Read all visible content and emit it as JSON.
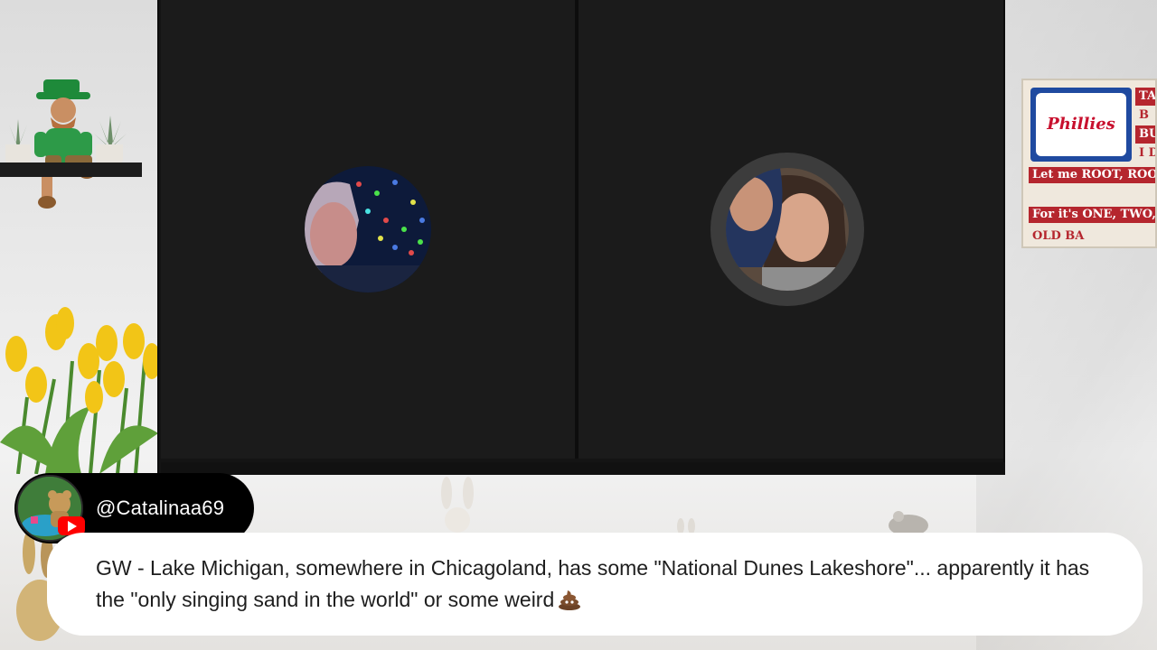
{
  "stream": {
    "participants": [
      {
        "name": "participant-left",
        "speaking": false
      },
      {
        "name": "participant-right",
        "speaking": true
      }
    ]
  },
  "chat": {
    "username": "@Catalinaa69",
    "platform_icon": "youtube-icon",
    "message": "GW - Lake Michigan, somewhere in Chicagoland, has some \"National Dunes Lakeshore\"... apparently it has the \"only singing sand in the world\" or some weird",
    "message_emoji": "poop-emoji"
  },
  "decor": {
    "sign_logo": "Phillies",
    "sign_lines": [
      "Let me ROOT, ROOT, R",
      "For it's ONE, TWO, TH",
      "OLD BA"
    ],
    "sign_side": [
      "TA",
      "B",
      "BU",
      "I DON'T"
    ]
  },
  "colors": {
    "stage_bg": "#141414",
    "tile_bg": "#1b1b1b",
    "speaking_ring": "#3c3c3c",
    "youtube_red": "#ff0000"
  }
}
